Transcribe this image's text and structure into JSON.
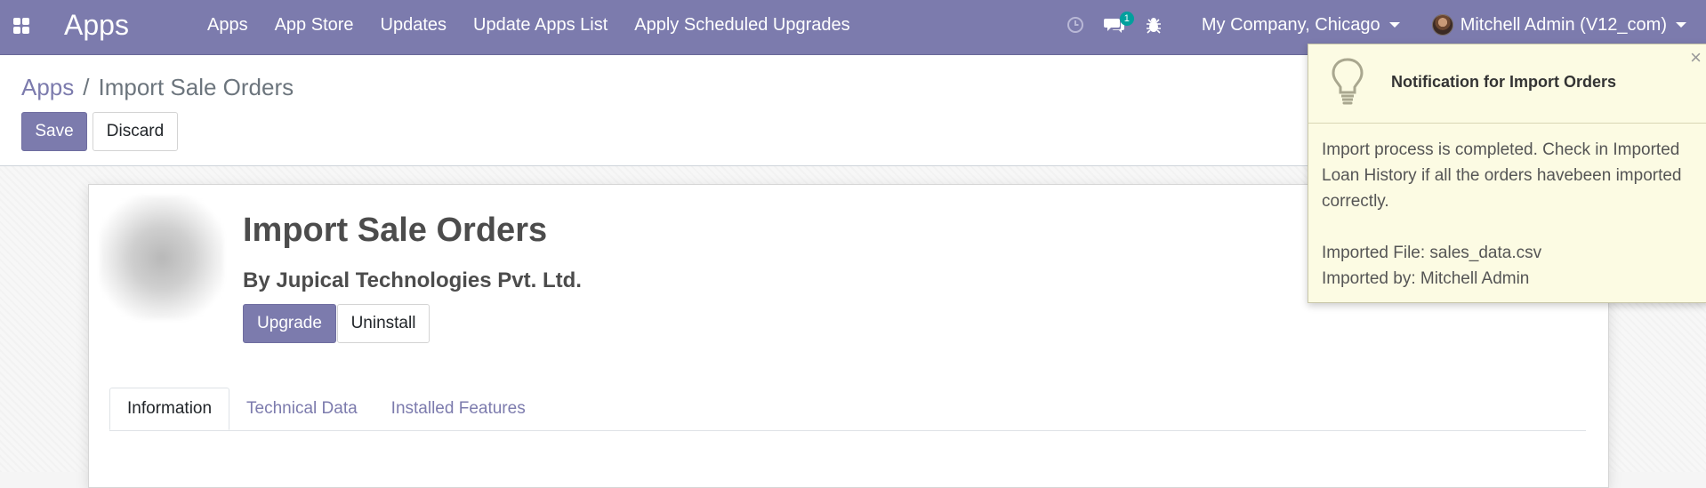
{
  "navbar": {
    "brand": "Apps",
    "menu": [
      "Apps",
      "App Store",
      "Updates",
      "Update Apps List",
      "Apply Scheduled Upgrades"
    ],
    "messages_count": "1",
    "company": "My Company, Chicago",
    "user": "Mitchell Admin (V12_com)",
    "icons": [
      "apps-grid-icon",
      "clock-icon",
      "chat-icon",
      "bug-icon"
    ]
  },
  "breadcrumb": {
    "root": "Apps",
    "separator": "/",
    "current": "Import Sale Orders"
  },
  "control_buttons": {
    "save": "Save",
    "discard": "Discard"
  },
  "module": {
    "title": "Import Sale Orders",
    "author": "By Jupical Technologies Pvt. Ltd.",
    "upgrade": "Upgrade",
    "uninstall": "Uninstall",
    "tabs": [
      "Information",
      "Technical Data",
      "Installed Features"
    ],
    "active_tab": "Information"
  },
  "notification": {
    "title": "Notification for Import Orders",
    "close": "×",
    "message": "Import process is completed. Check in Imported Loan History if all the orders havebeen imported correctly.",
    "file_line": "Imported File: sales_data.csv",
    "user_line": "Imported by: Mitchell Admin"
  },
  "colors": {
    "primary": "#7c7bad",
    "badge": "#00a09d",
    "notification_bg": "#fcfbe3"
  }
}
